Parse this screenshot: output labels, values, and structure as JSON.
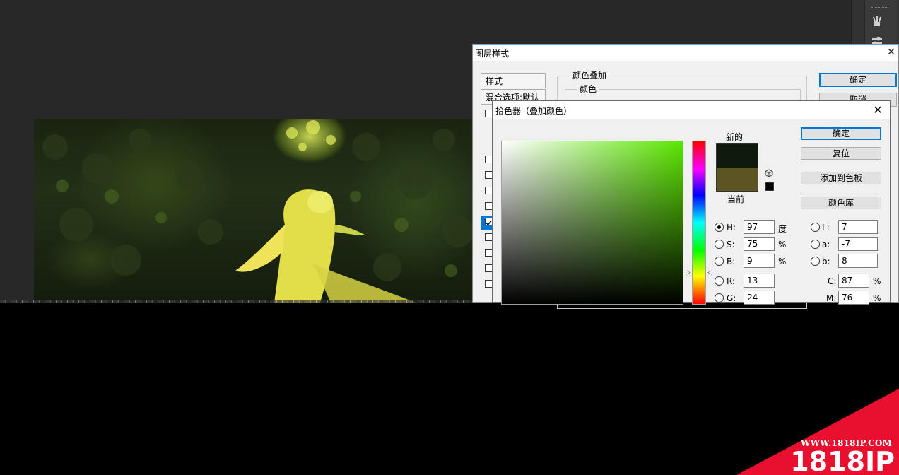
{
  "layer_style": {
    "title": "图层样式",
    "styles_header": "样式",
    "blend_options": "混合选项:默认",
    "group_title": "颜色叠加",
    "sub_title": "颜色",
    "ok": "确定",
    "cancel": "取消"
  },
  "color_picker": {
    "title": "拾色器（叠加颜色）",
    "new_label": "新的",
    "current_label": "当前",
    "new_color": "#101a0c",
    "current_color": "#5c5422",
    "buttons": {
      "ok": "确定",
      "reset": "复位",
      "add_swatch": "添加到色板",
      "color_libraries": "颜色库"
    },
    "hsb": {
      "h_label": "H:",
      "h_value": "97",
      "h_unit": "度",
      "s_label": "S:",
      "s_value": "75",
      "s_unit": "%",
      "b_label": "B:",
      "b_value": "9",
      "b_unit": "%"
    },
    "rgb": {
      "r_label": "R:",
      "r_value": "13",
      "g_label": "G:",
      "g_value": "24"
    },
    "lab": {
      "l_label": "L:",
      "l_value": "7",
      "a_label": "a:",
      "a_value": "-7",
      "b_label": "b:",
      "b_value": "8"
    },
    "cmyk": {
      "c_label": "C:",
      "c_value": "87",
      "c_unit": "%",
      "m_label": "M:",
      "m_value": "76",
      "m_unit": "%"
    },
    "selected_mode": "H"
  },
  "watermark": {
    "url": "WWW.1818IP.COM",
    "brand": "1818IP",
    "color": "#e8102e"
  },
  "icons": {
    "close": "close-icon",
    "cube": "gamut-cube-icon",
    "tool1": "brush-tool-icon",
    "tool2": "adjust-tool-icon"
  }
}
